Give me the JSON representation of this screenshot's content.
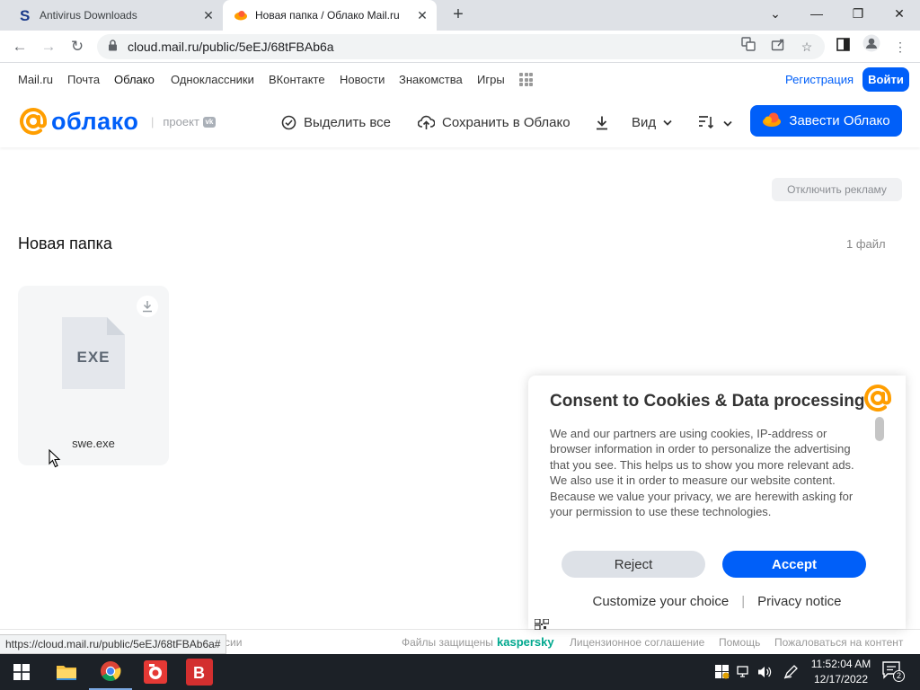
{
  "browser": {
    "tabs": [
      {
        "title": "Antivirus Downloads",
        "active": false
      },
      {
        "title": "Новая папка / Облако Mail.ru",
        "active": true
      }
    ],
    "new_tab": "+",
    "window_controls": {
      "dropdown": "⌄",
      "minimize": "—",
      "restore": "❐",
      "close": "✕"
    },
    "address": "cloud.mail.ru/public/5eEJ/68tFBAb6a",
    "status_url": "https://cloud.mail.ru/public/5eEJ/68tFBAb6a#"
  },
  "portal_nav": {
    "items": [
      "Mail.ru",
      "Почта",
      "Облако",
      "Одноклассники",
      "ВКонтакте",
      "Новости",
      "Знакомства",
      "Игры"
    ],
    "register": "Регистрация",
    "login": "Войти"
  },
  "cloud_header": {
    "logo_text": "облако",
    "project_label": "проект",
    "vk_badge": "vk",
    "select_all": "Выделить все",
    "save_to_cloud": "Сохранить в Облако",
    "view": "Вид",
    "cta": "Завести Облако"
  },
  "content": {
    "ad_off": "Отключить рекламу",
    "folder_title": "Новая папка",
    "file_count": "1 файл",
    "files": [
      {
        "name": "swe.exe",
        "ext": "EXE"
      }
    ]
  },
  "footer": {
    "left_partial": "сии",
    "protected": "Файлы защищены",
    "kaspersky": "kaspersky",
    "license": "Лицензионное соглашение",
    "help": "Помощь",
    "complain": "Пожаловаться на контент"
  },
  "consent": {
    "title": "Consent to Cookies & Data processing",
    "text": "We and our partners are using cookies, IP-address or browser information in order to personalize the advertising that you see. This helps us to show you more relevant ads. We also use it in order to measure our website content. Because we value your privacy, we are herewith asking for your permission to use these technologies.",
    "reject": "Reject",
    "accept": "Accept",
    "customize": "Customize your choice",
    "separator": "|",
    "privacy": "Privacy notice"
  },
  "taskbar": {
    "time": "11:52:04 AM",
    "date": "12/17/2022",
    "notifications": "2"
  },
  "colors": {
    "brand_blue": "#005ff9",
    "brand_orange": "#ff9e00",
    "taskbar": "#1c2127"
  }
}
